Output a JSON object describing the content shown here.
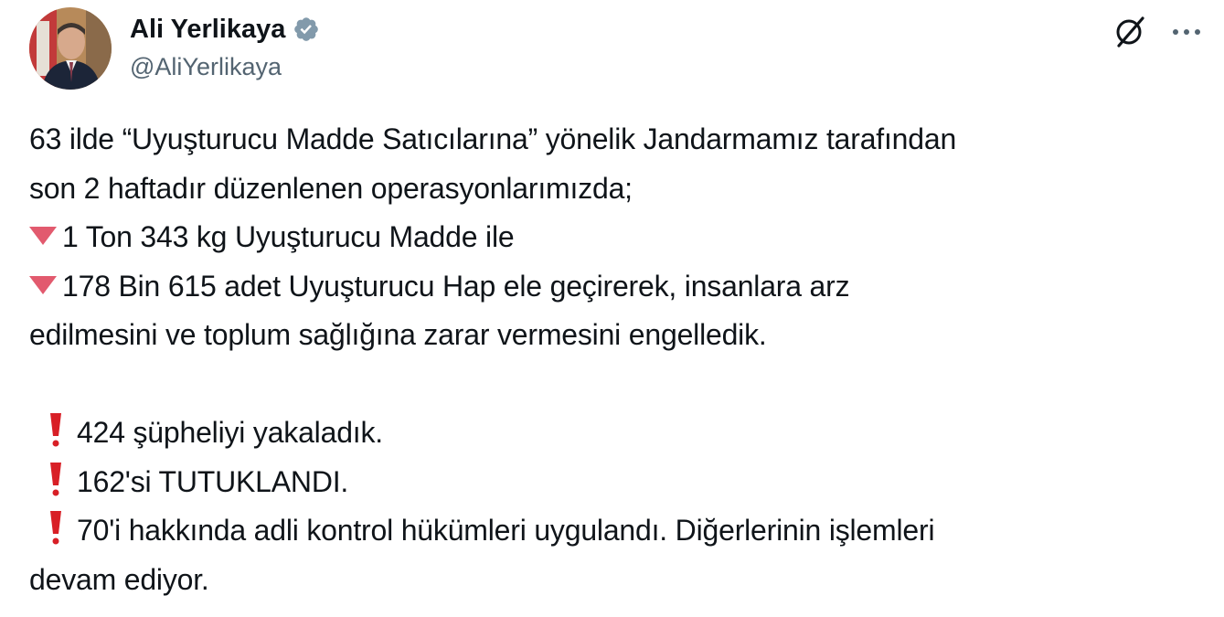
{
  "author": {
    "display_name": "Ali Yerlikaya",
    "handle": "@AliYerlikaya",
    "verified_icon": "verified-badge-icon"
  },
  "actions": {
    "grok_icon": "grok-icon",
    "more_icon": "more-options-icon"
  },
  "tweet": {
    "line1": "63 ilde “Uyuşturucu Madde Satıcılarına” yönelik Jandarmamız tarafından",
    "line2": "son 2 haftadır düzenlenen operasyonlarımızda;",
    "line3": "1 Ton 343 kg Uyuşturucu Madde ile",
    "line4": "178 Bin 615 adet Uyuşturucu Hap ele geçirerek, insanlara arz",
    "line5": "edilmesini ve toplum sağlığına zarar vermesini engelledik.",
    "line6": "424 şüpheliyi yakaladık.",
    "line7": "162'si TUTUKLANDI.",
    "line8": "70'i hakkında adli kontrol hükümleri uygulandı. Diğerlerinin işlemleri",
    "line9": "devam ediyor.",
    "bullet_triangle_icon": "red-triangle-down-icon",
    "bullet_exclamation_icon": "red-exclamation-icon"
  },
  "colors": {
    "text": "#0f1419",
    "secondary": "#536471",
    "verified": "#829aab",
    "accent_red": "#e25a6e"
  }
}
